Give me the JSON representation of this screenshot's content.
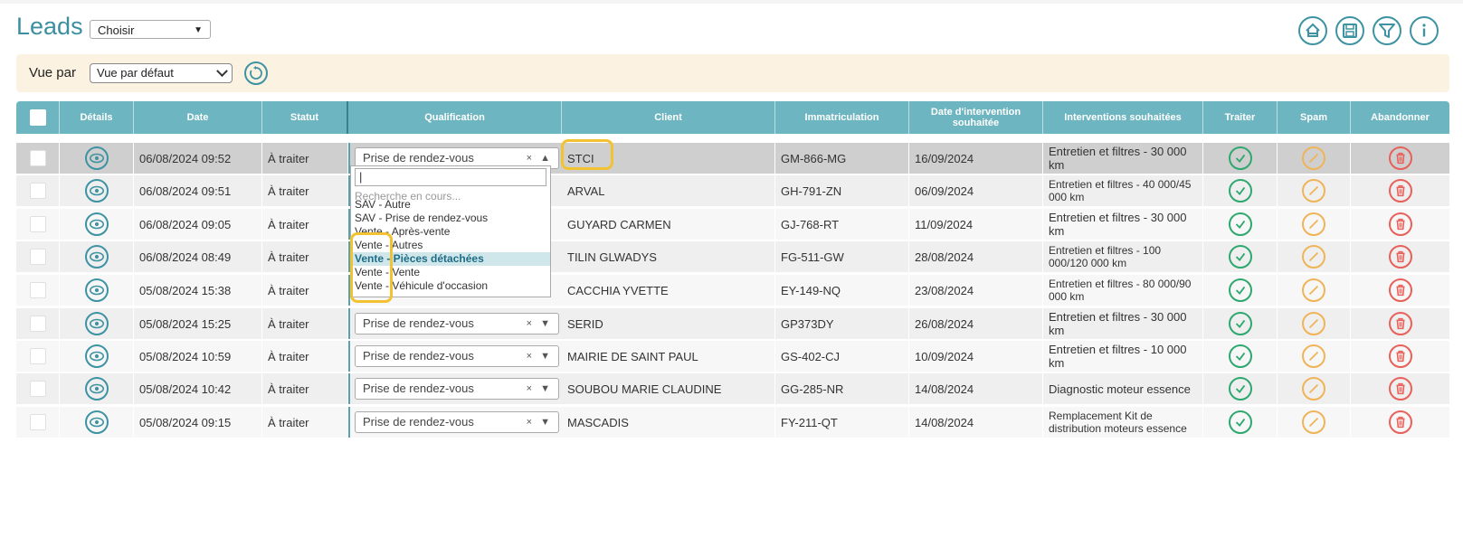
{
  "header": {
    "title": "Leads",
    "choose_select": "Choisir",
    "icons": [
      "home-icon",
      "save-icon",
      "filter-icon",
      "info-icon"
    ]
  },
  "viewbar": {
    "label": "Vue par",
    "view_select": "Vue par défaut"
  },
  "columns": [
    "Détails",
    "Date",
    "Statut",
    "Qualification",
    "Client",
    "Immatriculation",
    "Date d'intervention souhaitée",
    "Interventions souhaitées",
    "Traiter",
    "Spam",
    "Abandonner"
  ],
  "rows": [
    {
      "date": "06/08/2024 09:52",
      "statut": "À traiter",
      "qualification": "Prise de rendez-vous",
      "client": "STCI",
      "immat": "GM-866-MG",
      "date_int": "16/09/2024",
      "interv": "Entretien et filtres - 30 000 km",
      "bg": "#cfcfcf"
    },
    {
      "date": "06/08/2024 09:51",
      "statut": "À traiter",
      "qualification": "",
      "client": "ARVAL",
      "immat": "GH-791-ZN",
      "date_int": "06/09/2024",
      "interv": "Entretien et filtres - 40 000/45 000 km",
      "bg": "#efefef"
    },
    {
      "date": "06/08/2024 09:05",
      "statut": "À traiter",
      "qualification": "",
      "client": "GUYARD CARMEN",
      "immat": "GJ-768-RT",
      "date_int": "11/09/2024",
      "interv": "Entretien et filtres - 30 000 km",
      "bg": "#f7f7f7"
    },
    {
      "date": "06/08/2024 08:49",
      "statut": "À traiter",
      "qualification": "",
      "client": "TILIN GLWADYS",
      "immat": "FG-511-GW",
      "date_int": "28/08/2024",
      "interv": "Entretien et filtres - 100 000/120 000 km",
      "bg": "#efefef"
    },
    {
      "date": "05/08/2024 15:38",
      "statut": "À traiter",
      "qualification": "",
      "client": "CACCHIA YVETTE",
      "immat": "EY-149-NQ",
      "date_int": "23/08/2024",
      "interv": "Entretien et filtres - 80 000/90 000 km",
      "bg": "#f7f7f7"
    },
    {
      "date": "05/08/2024 15:25",
      "statut": "À traiter",
      "qualification": "Prise de rendez-vous",
      "client": "SERID",
      "immat": "GP373DY",
      "date_int": "26/08/2024",
      "interv": "Entretien et filtres - 30 000 km",
      "bg": "#efefef"
    },
    {
      "date": "05/08/2024 10:59",
      "statut": "À traiter",
      "qualification": "Prise de rendez-vous",
      "client": "MAIRIE DE SAINT PAUL",
      "immat": "GS-402-CJ",
      "date_int": "10/09/2024",
      "interv": "Entretien et filtres - 10 000 km",
      "bg": "#f7f7f7"
    },
    {
      "date": "05/08/2024 10:42",
      "statut": "À traiter",
      "qualification": "Prise de rendez-vous",
      "client": "SOUBOU MARIE CLAUDINE",
      "immat": "GG-285-NR",
      "date_int": "14/08/2024",
      "interv": "Diagnostic moteur essence",
      "bg": "#efefef"
    },
    {
      "date": "05/08/2024 09:15",
      "statut": "À traiter",
      "qualification": "Prise de rendez-vous",
      "client": "MASCADIS",
      "immat": "FY-211-QT",
      "date_int": "14/08/2024",
      "interv": "Remplacement Kit de distribution moteurs essence",
      "bg": "#f7f7f7"
    }
  ],
  "dropdown": {
    "search_value": "|",
    "hint": "Recherche en cours...",
    "options": [
      "SAV - Autre",
      "SAV - Prise de rendez-vous",
      "Vente - Après-vente",
      "Vente - Autres",
      "Vente - Pièces détachées",
      "Vente - Vente",
      "Vente - Véhicule d'occasion"
    ],
    "highlighted_index": 4
  },
  "colors": {
    "accent": "#3e93a3",
    "header_bg": "#6db5c0",
    "viewbar_bg": "#fcf2e1",
    "ok": "#2ea86f",
    "spam": "#f0b458",
    "delete": "#e8605a",
    "highlight": "#f2c232"
  }
}
